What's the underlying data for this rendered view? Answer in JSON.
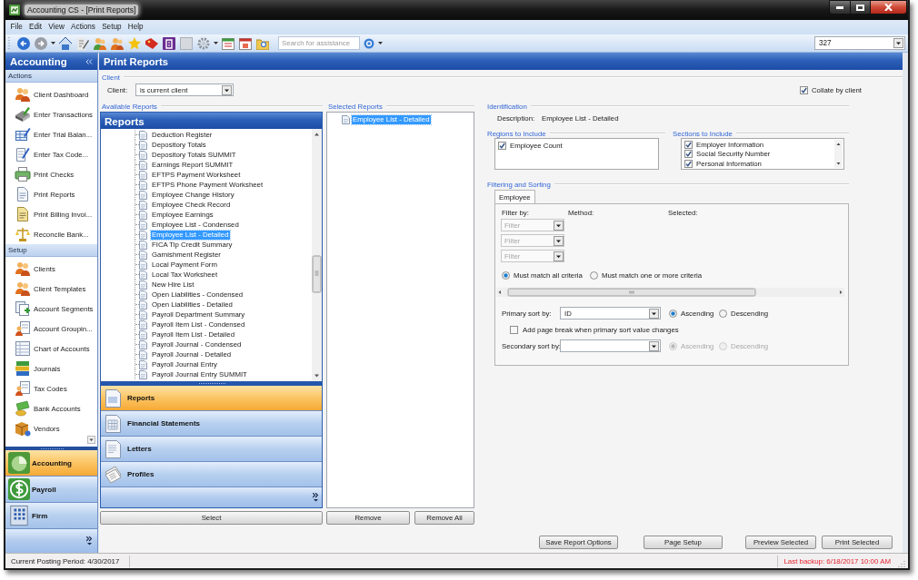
{
  "window": {
    "title": "Accounting CS - [Print Reports]"
  },
  "menu": [
    "File",
    "Edit",
    "View",
    "Actions",
    "Setup",
    "Help"
  ],
  "toolbar": {
    "search": {
      "placeholder": "Search for assistance"
    },
    "client_number": "327"
  },
  "sidebar": {
    "title": "Accounting",
    "groups": [
      {
        "label": "Actions",
        "items": [
          "Client Dashboard",
          "Enter Transactions",
          "Enter Trial Balan...",
          "Enter Tax Code...",
          "Print Checks",
          "Print Reports",
          "Print Billing Invoi...",
          "Reconcile Bank..."
        ]
      },
      {
        "label": "Setup",
        "items": [
          "Clients",
          "Client Templates",
          "Account Segments",
          "Account Groupin...",
          "Chart of Accounts",
          "Journals",
          "Tax Codes",
          "Bank Accounts",
          "Vendors"
        ]
      }
    ],
    "modules": [
      {
        "label": "Accounting",
        "selected": true
      },
      {
        "label": "Payroll",
        "selected": false
      },
      {
        "label": "Firm",
        "selected": false
      }
    ]
  },
  "page": {
    "title": "Print Reports",
    "client_section": {
      "heading": "Client",
      "label": "Client:",
      "value": "is current client"
    },
    "collate_by_client": {
      "label": "Collate by client",
      "checked": true
    },
    "available_reports": {
      "heading": "Available Reports",
      "panel_title": "Reports",
      "items": [
        {
          "label": "Deduction Register",
          "selected": false
        },
        {
          "label": "Depository Totals",
          "selected": false
        },
        {
          "label": "Depository Totals SUMMIT",
          "selected": false
        },
        {
          "label": "Earnings Report SUMMIT",
          "selected": false
        },
        {
          "label": "EFTPS Payment Worksheet",
          "selected": false
        },
        {
          "label": "EFTPS Phone Payment Worksheet",
          "selected": false
        },
        {
          "label": "Employee Change History",
          "selected": false
        },
        {
          "label": "Employee Check Record",
          "selected": false
        },
        {
          "label": "Employee Earnings",
          "selected": false
        },
        {
          "label": "Employee List - Condensed",
          "selected": false
        },
        {
          "label": "Employee List - Detailed",
          "selected": true
        },
        {
          "label": "FICA Tip Credit Summary",
          "selected": false
        },
        {
          "label": "Garnishment Register",
          "selected": false
        },
        {
          "label": "Local Payment Form",
          "selected": false
        },
        {
          "label": "Local Tax Worksheet",
          "selected": false
        },
        {
          "label": "New Hire List",
          "selected": false
        },
        {
          "label": "Open Liabilities - Condensed",
          "selected": false
        },
        {
          "label": "Open Liabilities - Detailed",
          "selected": false
        },
        {
          "label": "Payroll Department Summary",
          "selected": false
        },
        {
          "label": "Payroll Item List - Condensed",
          "selected": false
        },
        {
          "label": "Payroll Item List - Detailed",
          "selected": false
        },
        {
          "label": "Payroll Journal - Condensed",
          "selected": false
        },
        {
          "label": "Payroll Journal - Detailed",
          "selected": false
        },
        {
          "label": "Payroll Journal Entry",
          "selected": false
        },
        {
          "label": "Payroll Journal Entry SUMMIT",
          "selected": false
        }
      ],
      "categories": [
        {
          "label": "Reports",
          "selected": true
        },
        {
          "label": "Financial Statements",
          "selected": false
        },
        {
          "label": "Letters",
          "selected": false
        },
        {
          "label": "Profiles",
          "selected": false
        }
      ],
      "select_button": "Select"
    },
    "selected_reports": {
      "heading": "Selected Reports",
      "items": [
        {
          "label": "Employee List - Detailed",
          "selected": true
        }
      ],
      "buttons": [
        "Remove",
        "Remove All"
      ]
    },
    "identification": {
      "heading": "Identification",
      "description_label": "Description:",
      "description": "Employee List - Detailed"
    },
    "regions": {
      "heading": "Regions to Include",
      "items": [
        {
          "label": "Employee Count",
          "checked": true
        }
      ]
    },
    "sections": {
      "heading": "Sections to Include",
      "items": [
        {
          "label": "Employer Information",
          "checked": true
        },
        {
          "label": "Social Security Number",
          "checked": true
        },
        {
          "label": "Personal Information",
          "checked": true
        }
      ]
    },
    "filtering": {
      "heading": "Filtering and Sorting",
      "tabs": [
        {
          "label": "Employee",
          "selected": true
        }
      ],
      "columns": [
        "Filter by:",
        "Method:",
        "Selected:"
      ],
      "filters": [
        {
          "placeholder": "Filter",
          "disabled": true
        },
        {
          "placeholder": "Filter",
          "disabled": true
        },
        {
          "placeholder": "Filter",
          "disabled": true
        }
      ],
      "match_mode": [
        {
          "label": "Must match all criteria",
          "selected": true
        },
        {
          "label": "Must match one or more criteria",
          "selected": false
        }
      ],
      "primary_sort": {
        "label": "Primary sort by:",
        "value": "ID",
        "order": [
          {
            "label": "Ascending",
            "selected": true
          },
          {
            "label": "Descending",
            "selected": false
          }
        ]
      },
      "page_break": {
        "label": "Add page break when primary sort value changes",
        "checked": false
      },
      "secondary_sort": {
        "label": "Secondary sort by:",
        "disabled": true,
        "order": [
          {
            "label": "Ascending",
            "selected": true
          },
          {
            "label": "Descending",
            "selected": false
          }
        ]
      }
    },
    "actions": [
      "Save Report Options",
      "Page Setup",
      "Preview Selected",
      "Print Selected"
    ]
  },
  "status_bar": {
    "posting_period": "Current Posting Period: 4/30/2017",
    "last_backup": "Last backup: 6/18/2017 10:00 AM"
  }
}
